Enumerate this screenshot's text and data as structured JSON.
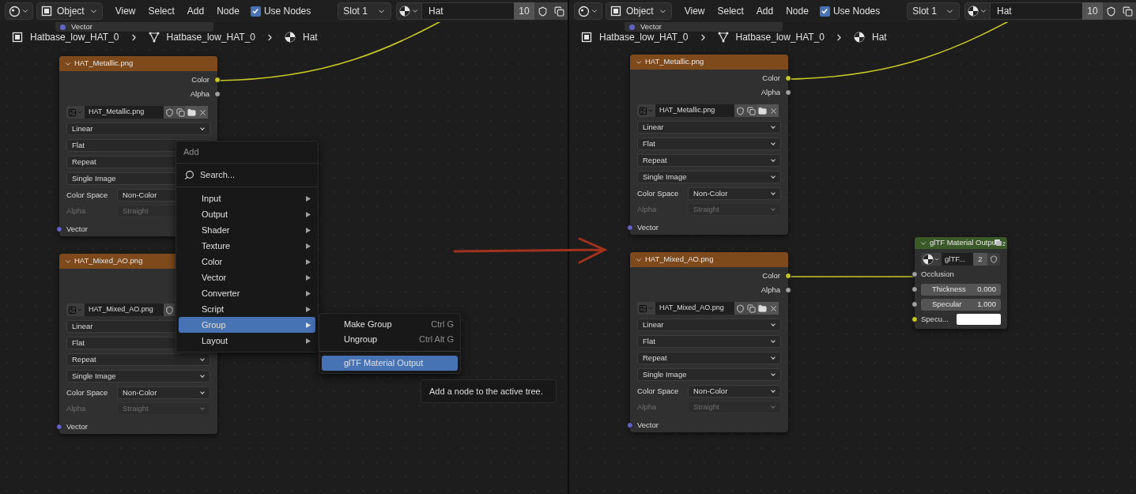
{
  "panels": [
    {
      "header": {
        "mode": "Object",
        "menus": [
          "View",
          "Select",
          "Add",
          "Node"
        ],
        "use_nodes": {
          "label": "Use Nodes",
          "checked": true
        },
        "slot": "Slot 1",
        "material": {
          "name": "Hat",
          "users": "10"
        }
      },
      "cut_node": {
        "inputs": [
          {
            "label": "Vector",
            "color": "#6363c7"
          }
        ]
      },
      "breadcrumb": [
        {
          "kind": "object",
          "label": "Hatbase_low_HAT_0"
        },
        {
          "kind": "mesh",
          "label": "Hatbase_low_HAT_0"
        },
        {
          "kind": "material",
          "label": "Hat"
        }
      ],
      "nodes": [
        {
          "kind": "image",
          "title": "HAT_Metallic.png",
          "outputs": [
            {
              "label": "Color",
              "color": "#c7c729",
              "linked": true
            },
            {
              "label": "Alpha",
              "color": "#a1a1a1",
              "linked": false
            }
          ],
          "image": {
            "name": "HAT_Metallic.png"
          },
          "dropdowns": [
            "Linear",
            "Flat",
            "Repeat",
            "Single Image"
          ],
          "properties": [
            {
              "label": "Color Space",
              "value": "Non-Color",
              "disabled": false
            },
            {
              "label": "Alpha",
              "value": "Straight",
              "disabled": true
            }
          ],
          "inputs": [
            {
              "label": "Vector",
              "color": "#6363c7"
            }
          ]
        },
        {
          "kind": "image",
          "title": "HAT_Mixed_AO.png",
          "image": {
            "name": "HAT_Mixed_AO.png",
            "full_toolbar": false
          },
          "dropdowns": [
            "Linear",
            "Flat",
            "Repeat",
            "Single Image"
          ],
          "properties": [
            {
              "label": "Color Space",
              "value": "Non-Color",
              "disabled": false
            },
            {
              "label": "Alpha",
              "value": "Straight",
              "disabled": true
            }
          ],
          "inputs": [
            {
              "label": "Vector",
              "color": "#6363c7"
            }
          ]
        }
      ],
      "menu": {
        "title": "Add",
        "search": "Search...",
        "items": [
          {
            "label": "Input",
            "submenu": true,
            "selected": false
          },
          {
            "label": "Output",
            "submenu": true,
            "selected": false
          },
          {
            "label": "Shader",
            "submenu": true,
            "selected": false
          },
          {
            "label": "Texture",
            "submenu": true,
            "selected": false
          },
          {
            "label": "Color",
            "submenu": true,
            "selected": false
          },
          {
            "label": "Vector",
            "submenu": true,
            "selected": false
          },
          {
            "label": "Converter",
            "submenu": true,
            "selected": false
          },
          {
            "label": "Script",
            "submenu": true,
            "selected": false
          },
          {
            "label": "Group",
            "submenu": true,
            "selected": true
          },
          {
            "label": "Layout",
            "submenu": true,
            "selected": false
          }
        ],
        "submenu": [
          {
            "label": "Make Group",
            "shortcut": "Ctrl G",
            "selected": false,
            "separator_before": false
          },
          {
            "label": "Ungroup",
            "shortcut": "Ctrl Alt G",
            "selected": false,
            "separator_before": false
          },
          {
            "label": "glTF Material Output",
            "selected": true,
            "separator_before": true
          }
        ],
        "tooltip": "Add a node to the active tree."
      }
    },
    {
      "header": {
        "mode": "Object",
        "menus": [
          "View",
          "Select",
          "Add",
          "Node"
        ],
        "use_nodes": {
          "label": "Use Nodes",
          "checked": true
        },
        "slot": "Slot 1",
        "material": {
          "name": "Hat",
          "users": "10"
        }
      },
      "cut_node": {
        "inputs": [
          {
            "label": "Vector",
            "color": "#6363c7"
          }
        ]
      },
      "breadcrumb": [
        {
          "kind": "object",
          "label": "Hatbase_low_HAT_0"
        },
        {
          "kind": "mesh",
          "label": "Hatbase_low_HAT_0"
        },
        {
          "kind": "material",
          "label": "Hat"
        }
      ],
      "nodes": [
        {
          "kind": "image",
          "title": "HAT_Metallic.png",
          "outputs": [
            {
              "label": "Color",
              "color": "#c7c729",
              "linked": true
            },
            {
              "label": "Alpha",
              "color": "#a1a1a1",
              "linked": false
            }
          ],
          "image": {
            "name": "HAT_Metallic.png"
          },
          "dropdowns": [
            "Linear",
            "Flat",
            "Repeat",
            "Single Image"
          ],
          "properties": [
            {
              "label": "Color Space",
              "value": "Non-Color",
              "disabled": false
            },
            {
              "label": "Alpha",
              "value": "Straight",
              "disabled": true
            }
          ],
          "inputs": [
            {
              "label": "Vector",
              "color": "#6363c7"
            }
          ]
        },
        {
          "kind": "image",
          "title": "HAT_Mixed_AO.png",
          "outputs": [
            {
              "label": "Color",
              "color": "#c7c729",
              "linked": true
            },
            {
              "label": "Alpha",
              "color": "#a1a1a1",
              "linked": false
            }
          ],
          "image": {
            "name": "HAT_Mixed_AO.png"
          },
          "dropdowns": [
            "Linear",
            "Flat",
            "Repeat",
            "Single Image"
          ],
          "properties": [
            {
              "label": "Color Space",
              "value": "Non-Color",
              "disabled": false
            },
            {
              "label": "Alpha",
              "value": "Straight",
              "disabled": true
            }
          ],
          "inputs": [
            {
              "label": "Vector",
              "color": "#6363c7"
            }
          ]
        },
        {
          "kind": "group",
          "title": "glTF Material Outpu",
          "badge": "2",
          "datablock": {
            "name": "glTF...",
            "users": "2"
          },
          "inputs": [
            {
              "kind": "label",
              "label": "Occlusion",
              "color": "#a1a1a1"
            },
            {
              "kind": "number",
              "label": "Thickness",
              "value": "0.000",
              "color": "#a1a1a1"
            },
            {
              "kind": "number",
              "label": "Specular",
              "value": "1.000",
              "color": "#a1a1a1"
            },
            {
              "kind": "swatch",
              "label": "Specu...",
              "color": "#c7c729"
            }
          ]
        }
      ]
    }
  ]
}
